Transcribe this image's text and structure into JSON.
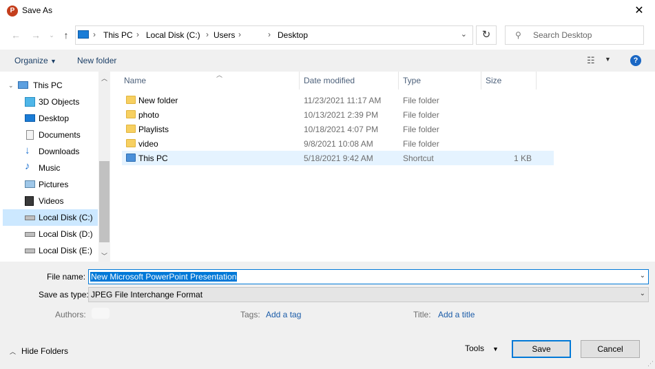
{
  "window": {
    "title": "Save As",
    "app_icon": "P"
  },
  "address": {
    "crumbs": [
      "This PC",
      "Local Disk (C:)",
      "Users",
      "",
      "Desktop"
    ],
    "search_placeholder": "Search Desktop"
  },
  "toolbar": {
    "organize": "Organize",
    "new_folder": "New folder"
  },
  "nav": {
    "items": [
      {
        "label": "This PC",
        "icon": "computer-icon"
      },
      {
        "label": "3D Objects",
        "icon": "3d-objects-icon"
      },
      {
        "label": "Desktop",
        "icon": "desktop-icon"
      },
      {
        "label": "Documents",
        "icon": "documents-icon"
      },
      {
        "label": "Downloads",
        "icon": "downloads-icon"
      },
      {
        "label": "Music",
        "icon": "music-icon"
      },
      {
        "label": "Pictures",
        "icon": "pictures-icon"
      },
      {
        "label": "Videos",
        "icon": "videos-icon"
      },
      {
        "label": "Local Disk (C:)",
        "icon": "drive-icon",
        "selected": true
      },
      {
        "label": "Local Disk (D:)",
        "icon": "drive-icon"
      },
      {
        "label": "Local Disk (E:)",
        "icon": "drive-icon"
      }
    ]
  },
  "columns": {
    "name": "Name",
    "date": "Date modified",
    "type": "Type",
    "size": "Size"
  },
  "files": [
    {
      "name": "New folder",
      "date": "11/23/2021 11:17 AM",
      "type": "File folder",
      "size": ""
    },
    {
      "name": "photo",
      "date": "10/13/2021 2:39 PM",
      "type": "File folder",
      "size": ""
    },
    {
      "name": "Playlists",
      "date": "10/18/2021 4:07 PM",
      "type": "File folder",
      "size": ""
    },
    {
      "name": "video",
      "date": "9/8/2021 10:08 AM",
      "type": "File folder",
      "size": ""
    },
    {
      "name": "This PC",
      "date": "5/18/2021 9:42 AM",
      "type": "Shortcut",
      "size": "1 KB"
    }
  ],
  "form": {
    "file_name_label": "File name:",
    "file_name_value": "New Microsoft PowerPoint Presentation",
    "save_as_type_label": "Save as type:",
    "save_as_type_value": "JPEG File Interchange Format",
    "authors_label": "Authors:",
    "tags_label": "Tags:",
    "tags_link": "Add a tag",
    "title_label": "Title:",
    "title_link": "Add a title",
    "hide_folders": "Hide Folders",
    "tools": "Tools",
    "save": "Save",
    "cancel": "Cancel"
  },
  "colors": {
    "accent": "#0078d7",
    "selected_nav": "#cce8ff",
    "selected_row": "#e5f3ff",
    "link": "#1a5ba8"
  }
}
